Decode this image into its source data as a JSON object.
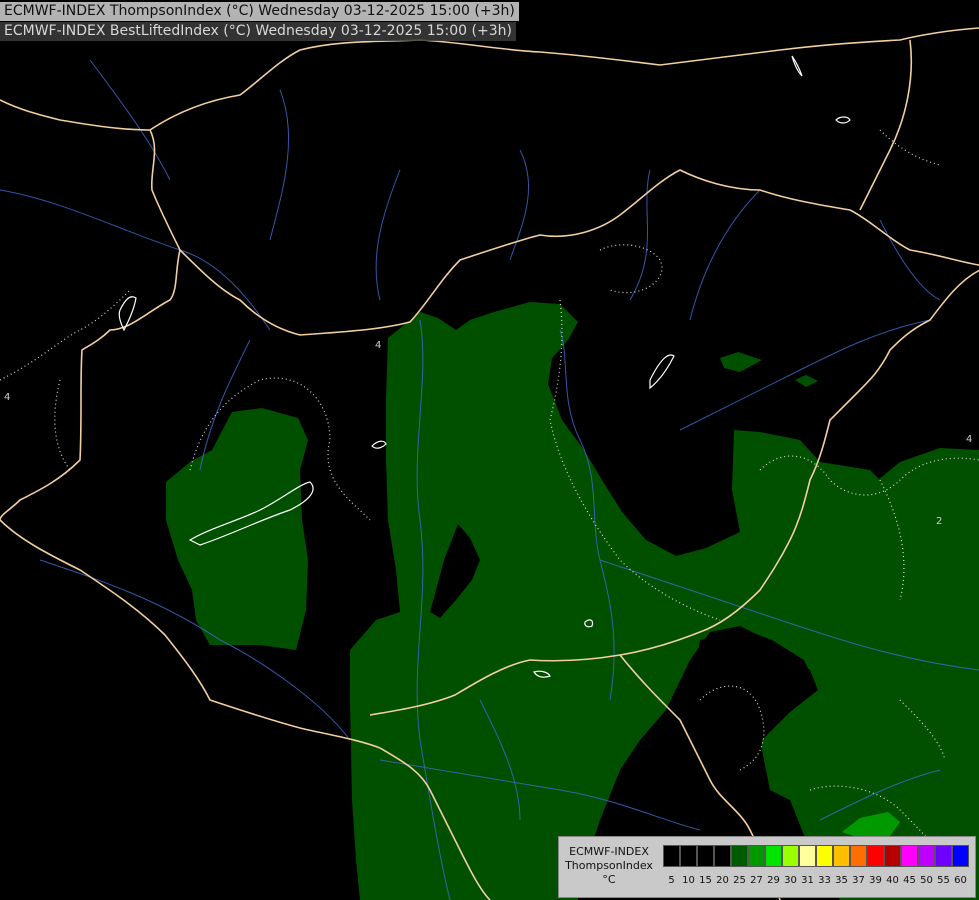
{
  "header": {
    "line1": "ECMWF-INDEX ThompsonIndex (°C) Wednesday 03-12-2025 15:00 (+3h)",
    "line2": "ECMWF-INDEX BestLiftedIndex (°C) Wednesday 03-12-2025 15:00 (+3h)"
  },
  "legend": {
    "title_line1": "ECMWF-INDEX",
    "title_line2": "ThompsonIndex",
    "title_line3": "°C",
    "colors": [
      "#000000",
      "#000000",
      "#000000",
      "#000000",
      "#005a00",
      "#009a00",
      "#00e400",
      "#9cff00",
      "#ffff9c",
      "#ffff00",
      "#ffbe00",
      "#ff6e00",
      "#ff0000",
      "#b40000",
      "#ff00ff",
      "#be00ff",
      "#6e00ff",
      "#0000ff"
    ],
    "ticks": [
      "5",
      "10",
      "15",
      "20",
      "25",
      "27",
      "29",
      "30",
      "31",
      "33",
      "35",
      "37",
      "39",
      "40",
      "45",
      "50",
      "55",
      "60"
    ]
  },
  "contour_labels": [
    "4",
    "4",
    "4",
    "2",
    "2"
  ],
  "colors": {
    "fill_dark_green": "#005000",
    "fill_light_green": "#009a00",
    "border_color": "#f2cfa0",
    "river_color": "#3e66c8",
    "contour_color": "#ffffff"
  }
}
